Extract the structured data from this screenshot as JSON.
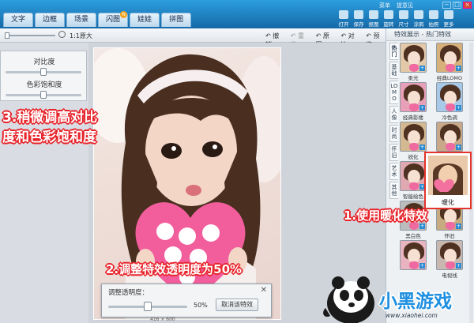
{
  "app": {
    "tabs": [
      {
        "label": "文字"
      },
      {
        "label": "边框"
      },
      {
        "label": "场景"
      },
      {
        "label": "闪图",
        "badge": "N"
      },
      {
        "label": "娃娃"
      },
      {
        "label": "拼图"
      }
    ],
    "top_links": [
      "菜单",
      "提意见"
    ],
    "tools": [
      {
        "label": "打开",
        "icon": "folder-icon"
      },
      {
        "label": "保存",
        "icon": "save-icon"
      },
      {
        "label": "抠图",
        "icon": "cutout-icon"
      },
      {
        "label": "旋转",
        "icon": "rotate-icon"
      },
      {
        "label": "尺寸",
        "icon": "resize-icon"
      },
      {
        "label": "涂鸦",
        "icon": "brush-icon"
      },
      {
        "label": "拍照",
        "icon": "camera-icon"
      },
      {
        "label": "更多",
        "icon": "more-icon"
      }
    ]
  },
  "toolbar": {
    "zoom_text": "1:1原大",
    "actions": [
      {
        "label": "撤销",
        "dim": false,
        "icon": "undo-icon"
      },
      {
        "label": "重做",
        "dim": true,
        "icon": "redo-icon"
      },
      {
        "label": "原图",
        "dim": false,
        "icon": "original-icon"
      },
      {
        "label": "对比",
        "dim": false,
        "icon": "compare-icon"
      },
      {
        "label": "预览",
        "dim": false,
        "icon": "preview-icon"
      }
    ]
  },
  "left_panel": {
    "contrast_label": "对比度",
    "contrast_value": 0.5,
    "saturation_label": "色彩饱和度",
    "saturation_value": 0.5
  },
  "right_panel": {
    "header": "特效展示 - 热门特效",
    "vtabs": [
      "热门",
      "基础",
      "LOMO",
      "人像",
      "时尚",
      "怀旧",
      "艺术",
      "其他"
    ],
    "active_vtab": 0,
    "effects": [
      {
        "label": "柔光",
        "tint": "#e4c9a8"
      },
      {
        "label": "经典LOMO",
        "tint": "#d8b07a"
      },
      {
        "label": "经典影楼",
        "tint": "#e8a0b8"
      },
      {
        "label": "冷色调",
        "tint": "#a8c8e8"
      },
      {
        "label": "锐化",
        "tint": "#d4b892"
      },
      {
        "label": "",
        "tint": "#c8a888"
      },
      {
        "label": "智能绘色",
        "tint": "#e0a8b0"
      },
      {
        "label": "",
        "tint": "#d4a890"
      },
      {
        "label": "黑白色",
        "tint": "#bcbcbc"
      },
      {
        "label": "怀旧",
        "tint": "#c8aa80"
      },
      {
        "label": "",
        "tint": "#e8b4c0"
      },
      {
        "label": "电视线",
        "tint": "#c8b8b0"
      }
    ],
    "selected_effect": {
      "label": "暖化",
      "tint": "#eccaa5"
    }
  },
  "dialog": {
    "title": "调整透明度：",
    "value_label": "50%",
    "value": 0.5,
    "cancel_label": "取消该特效"
  },
  "annotations": {
    "step1": "1.使用暖化特效",
    "step2": "2.调整特效透明度为50%",
    "step3": "3.稍微调高对比度和色彩饱和度"
  },
  "logo": {
    "text": "小黑游戏",
    "url": "www.xiaohei.com"
  },
  "status": {
    "dimensions": "416 × 600"
  },
  "colors": {
    "accent": "#1f7fc4",
    "annotation_red": "#e8232a"
  }
}
